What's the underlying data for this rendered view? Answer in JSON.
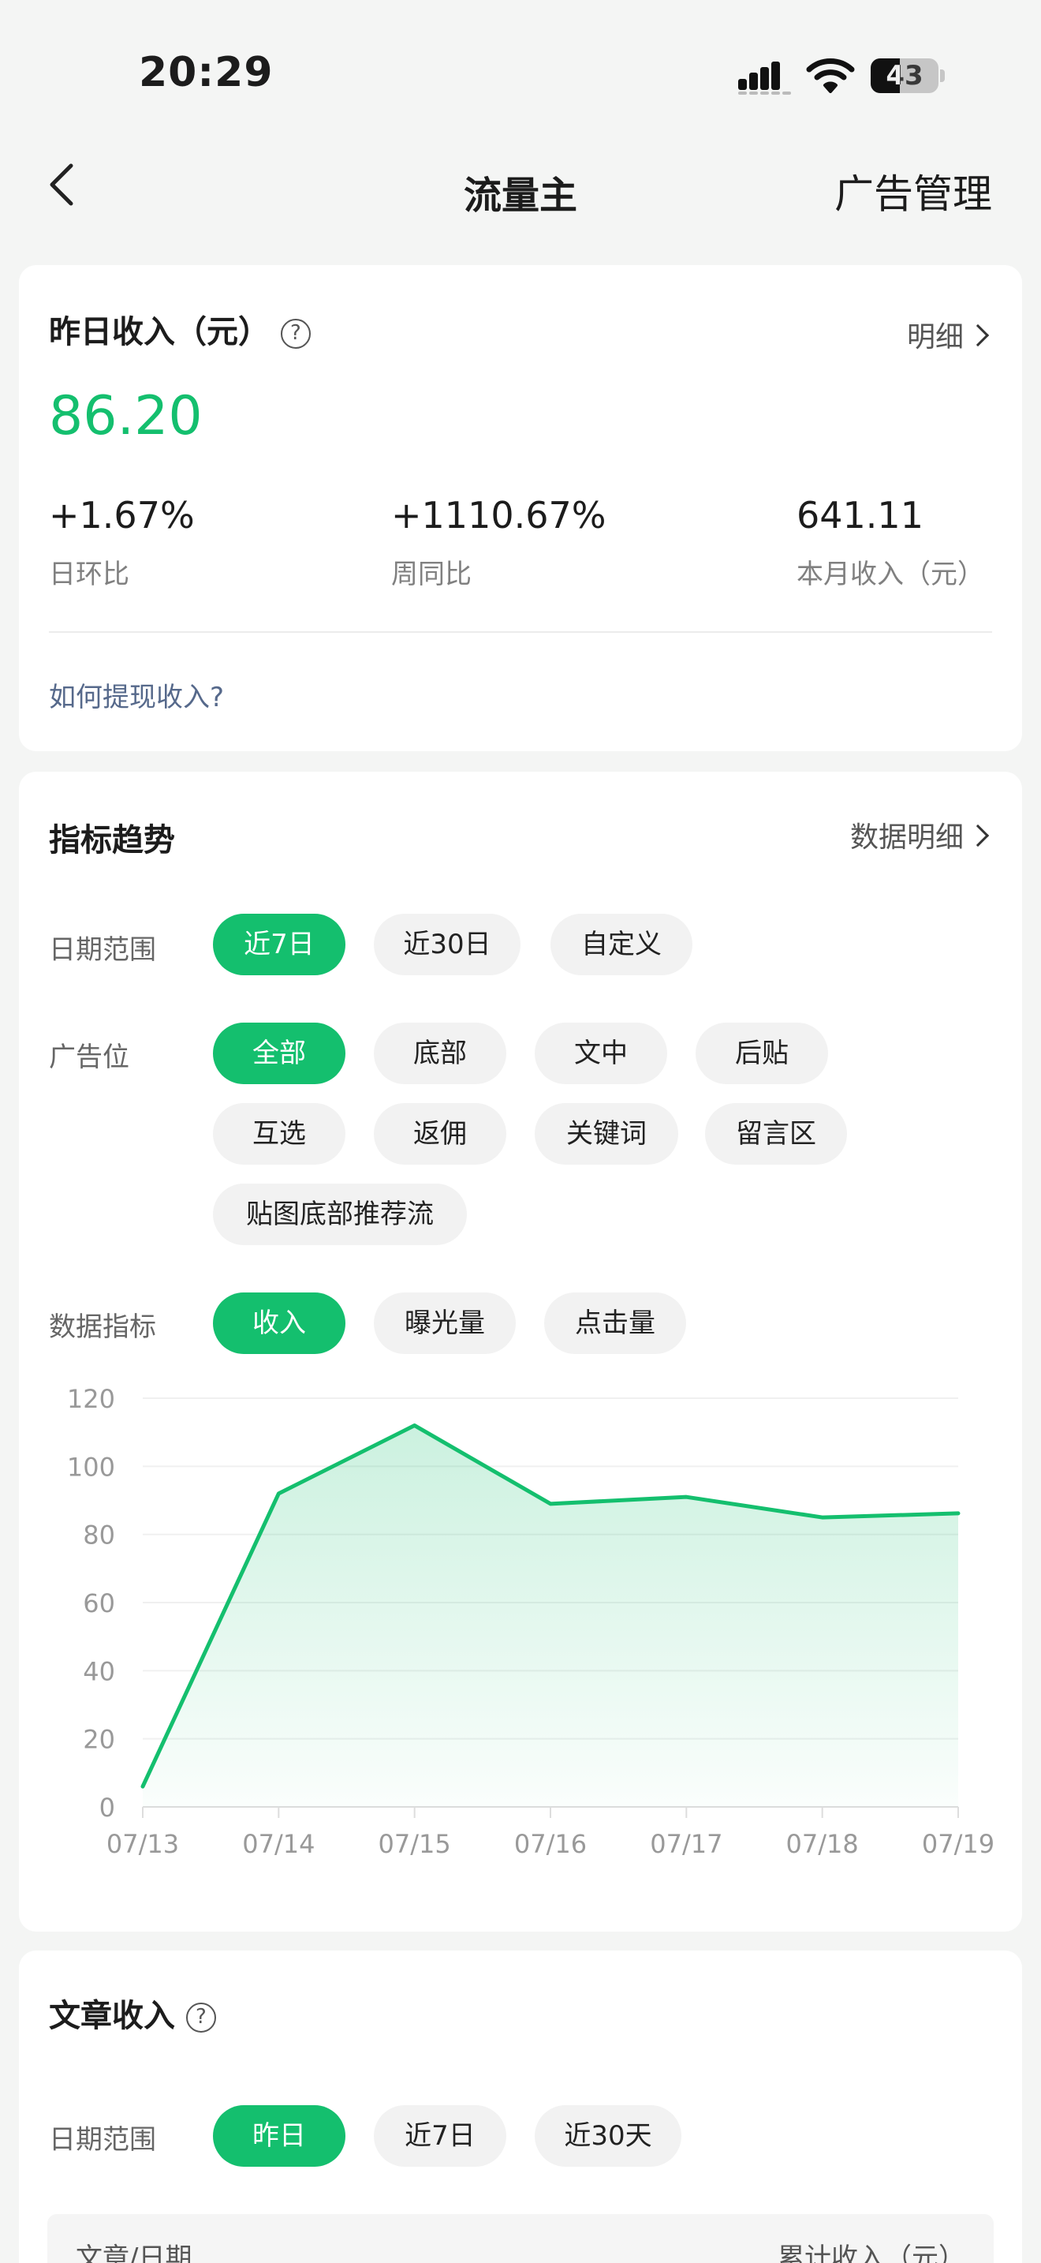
{
  "status_bar": {
    "time": "20:29",
    "battery": "43",
    "battery_level": 0.43
  },
  "nav": {
    "title": "流量主",
    "right_action": "广告管理"
  },
  "yesterday": {
    "title": "昨日收入（元）",
    "detail_link": "明细",
    "amount": "86.20",
    "metrics": [
      {
        "value": "+1.67%",
        "label": "日环比"
      },
      {
        "value": "+1110.67%",
        "label": "周同比"
      },
      {
        "value": "641.11",
        "label": "本月收入（元）"
      }
    ],
    "withdraw_link": "如何提现收入?"
  },
  "trend": {
    "title": "指标趋势",
    "detail_link": "数据明细",
    "date_range": {
      "label": "日期范围",
      "options": [
        "近7日",
        "近30日",
        "自定义"
      ],
      "selected": 0
    },
    "ad_slot": {
      "label": "广告位",
      "options": [
        "全部",
        "底部",
        "文中",
        "后贴",
        "互选",
        "返佣",
        "关键词",
        "留言区",
        "贴图底部推荐流"
      ],
      "selected": 0
    },
    "metric": {
      "label": "数据指标",
      "options": [
        "收入",
        "曝光量",
        "点击量"
      ],
      "selected": 0
    }
  },
  "chart_data": {
    "type": "area",
    "x": [
      "07/13",
      "07/14",
      "07/15",
      "07/16",
      "07/17",
      "07/18",
      "07/19"
    ],
    "series": [
      {
        "values": [
          6,
          92,
          112,
          89,
          91,
          85,
          86.2
        ]
      }
    ],
    "y_ticks": [
      0,
      20,
      40,
      60,
      80,
      100,
      120
    ],
    "ylim": [
      0,
      120
    ],
    "grid": true,
    "color": "#14bf6e"
  },
  "article": {
    "title": "文章收入",
    "date_range": {
      "label": "日期范围",
      "options": [
        "昨日",
        "近7日",
        "近30天"
      ],
      "selected": 0
    },
    "table_header": {
      "left": "文章/日期",
      "right": "累计收入（元）"
    }
  }
}
